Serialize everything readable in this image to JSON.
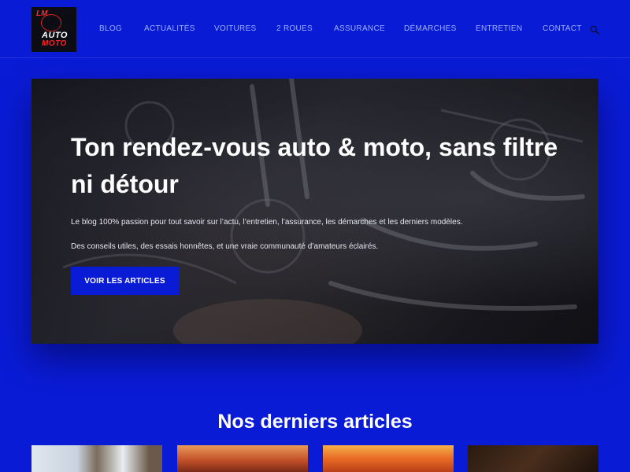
{
  "header": {
    "logo_alt": "LM Auto Moto",
    "home_label": "HOME",
    "nav": [
      {
        "label": "BLOG"
      },
      {
        "label": "ACTUALITÉS"
      },
      {
        "label": "VOITURES"
      },
      {
        "label": "2 ROUES"
      },
      {
        "label": "ASSURANCE"
      },
      {
        "label": "DÉMARCHES"
      },
      {
        "label": "ENTRETIEN"
      },
      {
        "label": "CONTACT"
      }
    ],
    "search_icon": "search-icon"
  },
  "hero": {
    "title": "Ton rendez-vous auto & moto, sans filtre ni détour",
    "paragraph_1": "Le blog 100% passion pour tout savoir sur l’actu, l’entretien, l’assurance, les démarches et les derniers modèles.",
    "paragraph_2": "Des conseils utiles, des essais honnêtes, et une vraie communauté d’amateurs éclairés.",
    "cta_label": "VOIR LES ARTICLES"
  },
  "latest": {
    "title": "Nos derniers articles"
  },
  "colors": {
    "background": "#0a1bd6",
    "nav_text": "#9db0ff",
    "button": "#0a1bd6"
  }
}
